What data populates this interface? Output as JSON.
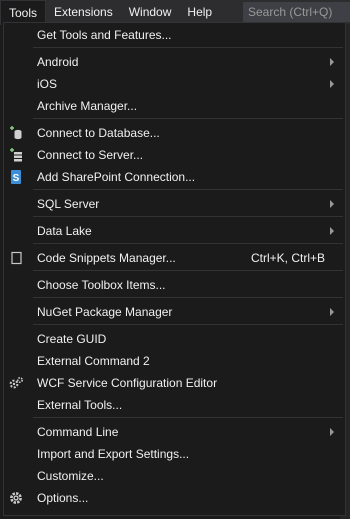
{
  "menubar": {
    "items": [
      "Tools",
      "Extensions",
      "Window",
      "Help"
    ],
    "search_placeholder": "Search (Ctrl+Q)"
  },
  "menu": {
    "items": [
      {
        "label": "Get Tools and Features..."
      },
      {
        "label": "Android",
        "submenu": true
      },
      {
        "label": "iOS",
        "submenu": true
      },
      {
        "label": "Archive Manager..."
      },
      {
        "label": "Connect to Database...",
        "icon": "add-database-icon"
      },
      {
        "label": "Connect to Server...",
        "icon": "add-server-icon"
      },
      {
        "label": "Add SharePoint Connection...",
        "icon": "sharepoint-icon"
      },
      {
        "label": "SQL Server",
        "submenu": true
      },
      {
        "label": "Data Lake",
        "submenu": true
      },
      {
        "label": "Code Snippets Manager...",
        "shortcut": "Ctrl+K, Ctrl+B",
        "icon": "code-snippets-icon"
      },
      {
        "label": "Choose Toolbox Items..."
      },
      {
        "label": "NuGet Package Manager",
        "submenu": true
      },
      {
        "label": "Create GUID"
      },
      {
        "label": "External Command 2"
      },
      {
        "label": "WCF Service Configuration Editor",
        "icon": "wcf-config-icon"
      },
      {
        "label": "External Tools..."
      },
      {
        "label": "Command Line",
        "submenu": true
      },
      {
        "label": "Import and Export Settings..."
      },
      {
        "label": "Customize..."
      },
      {
        "label": "Options...",
        "icon": "gear-icon"
      }
    ]
  }
}
